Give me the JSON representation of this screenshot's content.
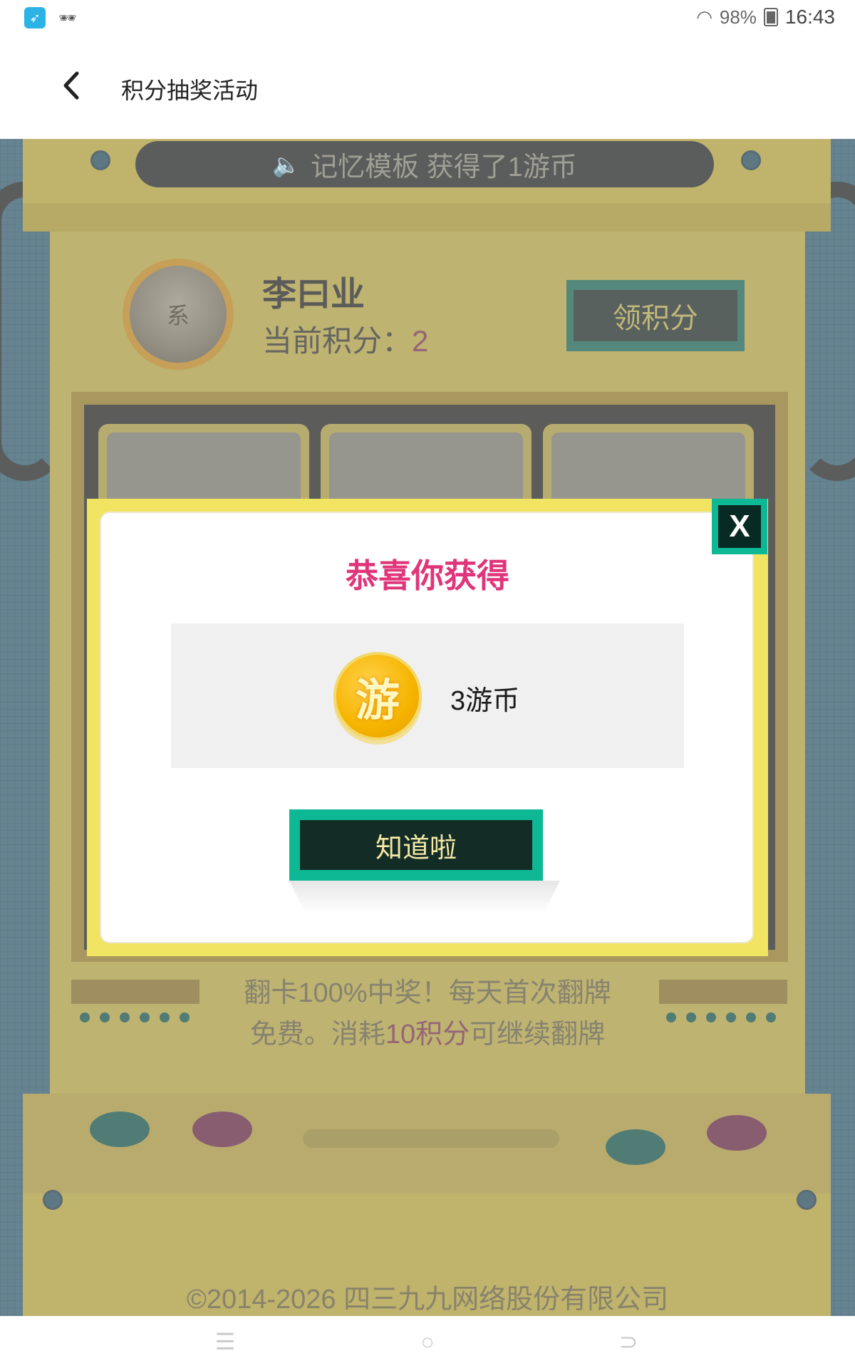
{
  "statusbar": {
    "battery": "98%",
    "time": "16:43"
  },
  "header": {
    "title": "积分抽奖活动"
  },
  "game": {
    "marquee": "记忆模板  获得了1游币",
    "user_name": "李曰业",
    "points_label": "当前积分：",
    "points_value": "2",
    "collect_button": "领积分",
    "promo_line1": "翻卡100%中奖！每天首次翻牌",
    "promo_line2_a": "免费。消耗",
    "promo_line2_hl": "10积分",
    "promo_line2_b": "可继续翻牌",
    "copyright": "©2014-2026 四三九九网络股份有限公司"
  },
  "modal": {
    "title": "恭喜你获得",
    "coin_char": "游",
    "prize": "3游币",
    "confirm_button": "知道啦",
    "close_label": "X"
  },
  "colors": {
    "accent_pink": "#e0357a",
    "accent_teal": "#0eb895",
    "modal_border": "#f2e463"
  }
}
